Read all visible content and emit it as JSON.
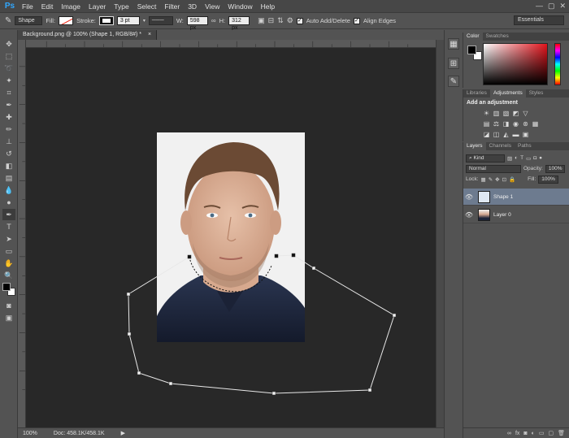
{
  "app": {
    "logo": "Ps"
  },
  "menu": [
    "File",
    "Edit",
    "Image",
    "Layer",
    "Type",
    "Select",
    "Filter",
    "3D",
    "View",
    "Window",
    "Help"
  ],
  "window_controls": [
    "—",
    "▢",
    "✕"
  ],
  "options": {
    "mode": "Shape",
    "fill_label": "Fill:",
    "stroke_label": "Stroke:",
    "stroke_width": "3 pt",
    "w_label": "W:",
    "w_value": "598 px",
    "h_label": "H:",
    "h_value": "312 px",
    "auto_add_delete": "Auto Add/Delete",
    "align_edges": "Align Edges",
    "workspace": "Essentials"
  },
  "document": {
    "tab_title": "Background.png @ 100% (Shape 1, RGB/8#) *"
  },
  "status": {
    "zoom": "100%",
    "doc_size": "Doc: 458.1K/458.1K"
  },
  "panels": {
    "color_tabs": [
      "Color",
      "Swatches"
    ],
    "adj_tabs": [
      "Libraries",
      "Adjustments",
      "Styles"
    ],
    "adj_title": "Add an adjustment",
    "layers_tabs": [
      "Layers",
      "Channels",
      "Paths"
    ],
    "kind_label": "Kind",
    "blend_mode": "Normal",
    "opacity_label": "Opacity:",
    "opacity_value": "100%",
    "lock_label": "Lock:",
    "fill_label": "Fill:",
    "fill_value": "100%",
    "layers": [
      {
        "name": "Shape 1",
        "selected": true
      },
      {
        "name": "Layer 0",
        "selected": false
      }
    ]
  },
  "colors": {
    "foreground": "#000000",
    "background": "#ffffff",
    "path_stroke": "#e8e8e8"
  }
}
